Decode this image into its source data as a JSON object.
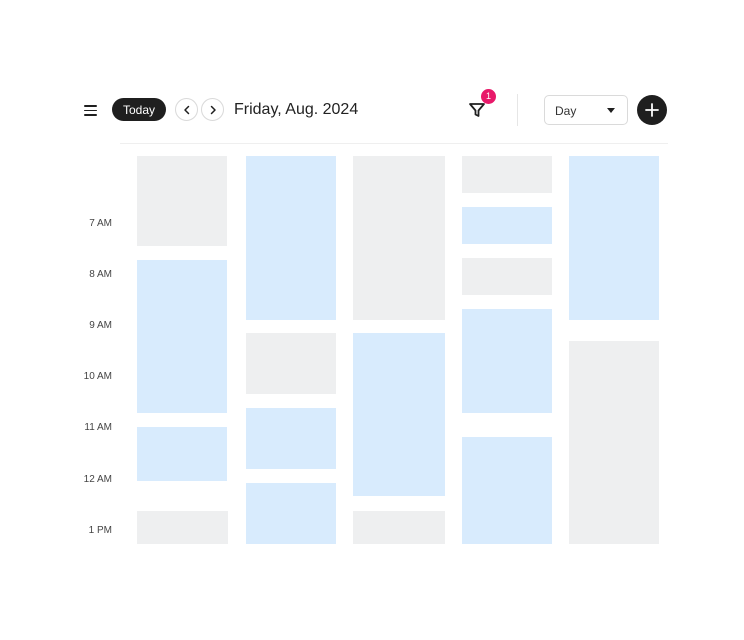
{
  "header": {
    "menu_icon": "hamburger-menu-icon",
    "today_label": "Today",
    "prev_icon": "chevron-left-icon",
    "next_icon": "chevron-right-icon",
    "date_title": "Friday, Aug. 2024",
    "filter_icon": "filter-funnel-icon",
    "filter_badge": "1",
    "view_select": {
      "selected": "Day"
    },
    "add_icon": "plus-icon"
  },
  "time_labels": [
    "7 AM",
    "8 AM",
    "9 AM",
    "10 AM",
    "11 AM",
    "12 AM",
    "1 PM"
  ],
  "colors": {
    "accent": "#1f1f1f",
    "badge": "#e8196a",
    "event_gray": "#eeeff0",
    "event_blue": "#d8ebfd"
  },
  "columns": [
    {
      "events": [
        "gray",
        "blue",
        "blue",
        "gray"
      ]
    },
    {
      "events": [
        "blue",
        "gray",
        "blue",
        "blue"
      ]
    },
    {
      "events": [
        "gray",
        "blue",
        "gray"
      ]
    },
    {
      "events": [
        "gray",
        "blue",
        "gray",
        "blue",
        "blue"
      ]
    },
    {
      "events": [
        "blue",
        "gray"
      ]
    }
  ]
}
